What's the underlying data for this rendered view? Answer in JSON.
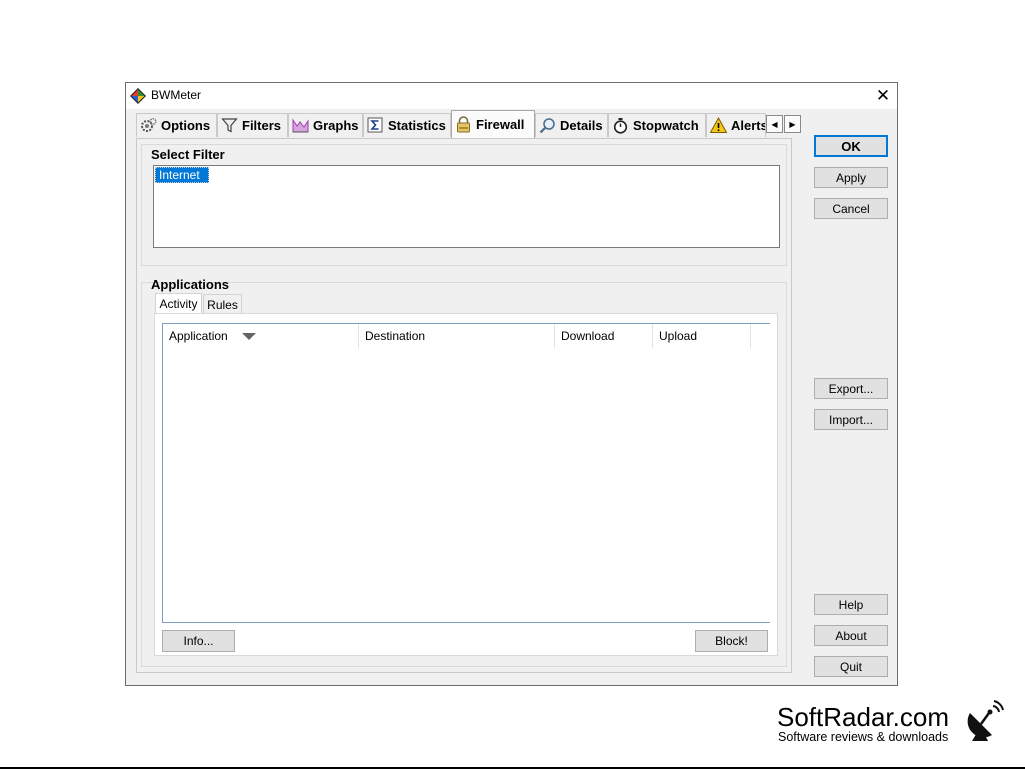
{
  "window": {
    "title": "BWMeter",
    "close_glyph": "✕",
    "app_icon": "bwmeter-diamond-icon"
  },
  "tabs": [
    {
      "label": "Options",
      "icon": "gears-icon",
      "active": false
    },
    {
      "label": "Filters",
      "icon": "funnel-icon",
      "active": false
    },
    {
      "label": "Graphs",
      "icon": "graph-icon",
      "active": false
    },
    {
      "label": "Statistics",
      "icon": "sigma-icon",
      "active": false
    },
    {
      "label": "Firewall",
      "icon": "padlock-icon",
      "active": true
    },
    {
      "label": "Details",
      "icon": "magnifier-icon",
      "active": false
    },
    {
      "label": "Stopwatch",
      "icon": "stopwatch-icon",
      "active": false
    },
    {
      "label": "Alerts",
      "icon": "warning-icon",
      "active": false
    }
  ],
  "tab_scroll": {
    "left": "◀",
    "right": "▶"
  },
  "select_filter": {
    "title": "Select Filter",
    "items": [
      "Internet"
    ],
    "selected": "Internet"
  },
  "applications": {
    "title": "Applications",
    "subtabs": [
      {
        "label": "Activity",
        "active": true
      },
      {
        "label": "Rules",
        "active": false
      }
    ],
    "columns": [
      "Application",
      "Destination",
      "Download",
      "Upload"
    ],
    "sort_column": "Application",
    "rows": [],
    "info_button": "Info...",
    "block_button": "Block!"
  },
  "side_buttons": {
    "ok": "OK",
    "apply": "Apply",
    "cancel": "Cancel",
    "export": "Export...",
    "import": "Import...",
    "help": "Help",
    "about": "About",
    "quit": "Quit"
  },
  "watermark": {
    "title": "SoftRadar.com",
    "subtitle": "Software reviews & downloads",
    "icon": "satellite-dish-icon"
  },
  "colors": {
    "selection": "#0078d7",
    "default_button_border": "#0078d7",
    "window_bg": "#f0f0f0"
  }
}
